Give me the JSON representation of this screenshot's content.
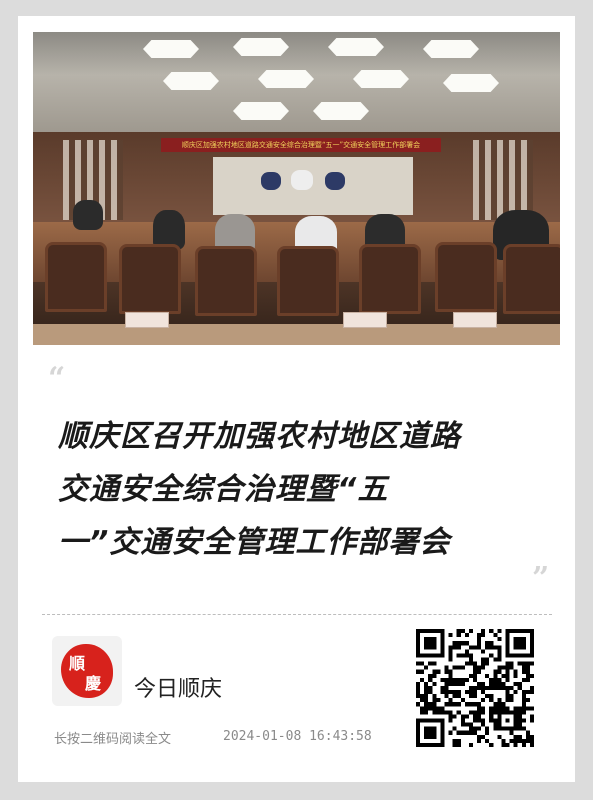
{
  "photo": {
    "description_icon": "meeting-room-photo",
    "banner_text": "顺庆区加强农村地区道路交通安全综合治理暨“五一”交通安全管理工作部署会"
  },
  "article": {
    "title": "顺庆区召开加强农村地区道路交通安全综合治理暨“五一”交通安全管理工作部署会",
    "title_lines": [
      "顺庆区召开加强农村地区道路",
      "交通安全综合治理暨“五",
      "一”交通安全管理工作部署会"
    ]
  },
  "source": {
    "logo_chars": [
      "順",
      "慶"
    ],
    "name": "今日顺庆",
    "logo_color": "#d7221c"
  },
  "footer": {
    "hint": "长按二维码阅读全文",
    "timestamp": "2024-01-08 16:43:58"
  },
  "qr_icon": "qr-code-icon",
  "colors": {
    "page_bg": "#dcdcdc",
    "card_bg": "#ffffff",
    "title": "#1a1a1a",
    "muted": "#8a8a8a"
  }
}
